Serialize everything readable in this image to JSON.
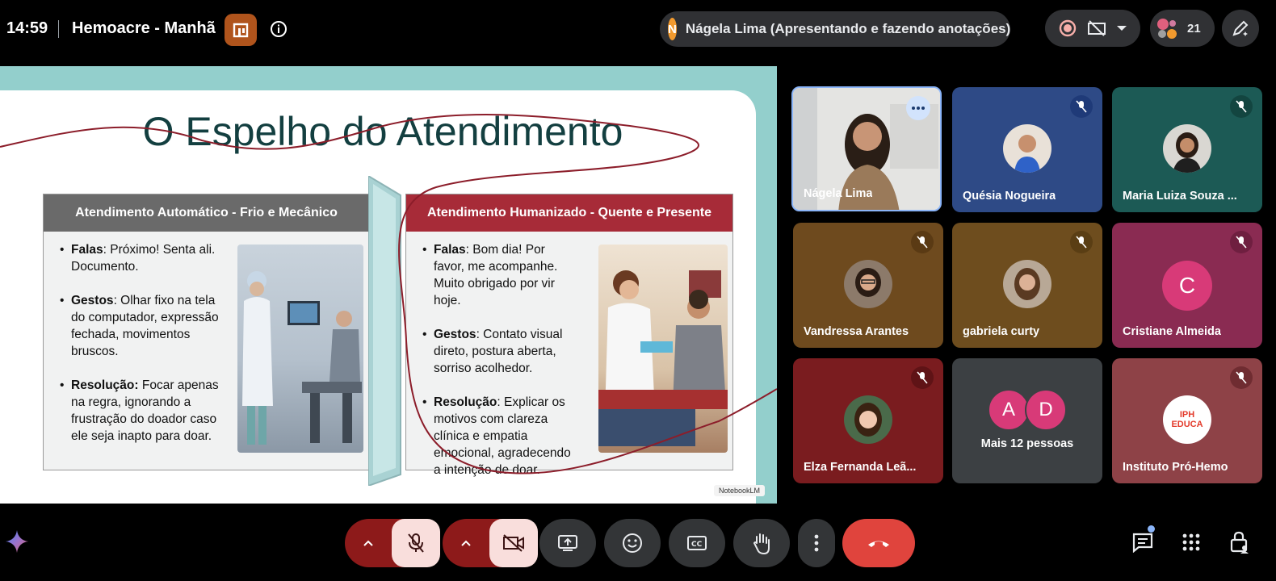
{
  "header": {
    "time": "14:59",
    "meeting_title": "Hemoacre - Manhã",
    "presenter": {
      "initial": "N",
      "text": "Nágela Lima (Apresentando e fazendo anotações)"
    },
    "participant_count": "21"
  },
  "slide": {
    "title": "O Espelho do Atendimento",
    "left": {
      "heading": "Atendimento Automático - Frio e Mecânico",
      "bullets": [
        {
          "label": "Falas",
          "text": ": Próximo! Senta ali. Documento."
        },
        {
          "label": "Gestos",
          "text": ": Olhar fixo na tela do computador, expressão fechada, movimentos bruscos."
        },
        {
          "label": "Resolução:",
          "text": " Focar apenas na regra, ignorando a frustração do doador caso ele seja inapto para doar."
        }
      ]
    },
    "right": {
      "heading": "Atendimento Humanizado - Quente e Presente",
      "bullets": [
        {
          "label": "Falas",
          "text": ": Bom dia! Por favor, me acompanhe. Muito obrigado por vir hoje."
        },
        {
          "label": "Gestos",
          "text": ": Contato visual direto, postura aberta, sorriso acolhedor."
        },
        {
          "label": "Resolução",
          "text": ": Explicar os motivos com clareza clínica e empatia emocional, agradecendo a intenção de doar."
        }
      ]
    },
    "watermark": "NotebookLM"
  },
  "participants": [
    {
      "name": "Nágela Lima",
      "bg": "#d8d8d8"
    },
    {
      "name": "Quésia Nogueira",
      "bg": "#2e4a86"
    },
    {
      "name": "Maria Luiza Souza ...",
      "bg": "#1c5a55"
    },
    {
      "name": "Vandressa Arantes",
      "bg": "#6e4a1e"
    },
    {
      "name": "gabriela curty",
      "bg": "#6e4d1e"
    },
    {
      "name": "Cristiane Almeida",
      "bg": "#8a2b52",
      "initial": "C"
    },
    {
      "name": "Elza Fernanda Leã...",
      "bg": "#7a1c1f"
    },
    {
      "name": "Mais 12 pessoas",
      "bg": "#3c4043",
      "initials": [
        "A",
        "D"
      ]
    },
    {
      "name": "Instituto Pró-Hemo",
      "bg": "#8e4247",
      "logo": [
        "IPH",
        "EDUCA"
      ]
    }
  ],
  "colors": {
    "accent_red": "#a72b38",
    "slide_teal": "#93cfcc",
    "leave_red": "#e0443d"
  }
}
